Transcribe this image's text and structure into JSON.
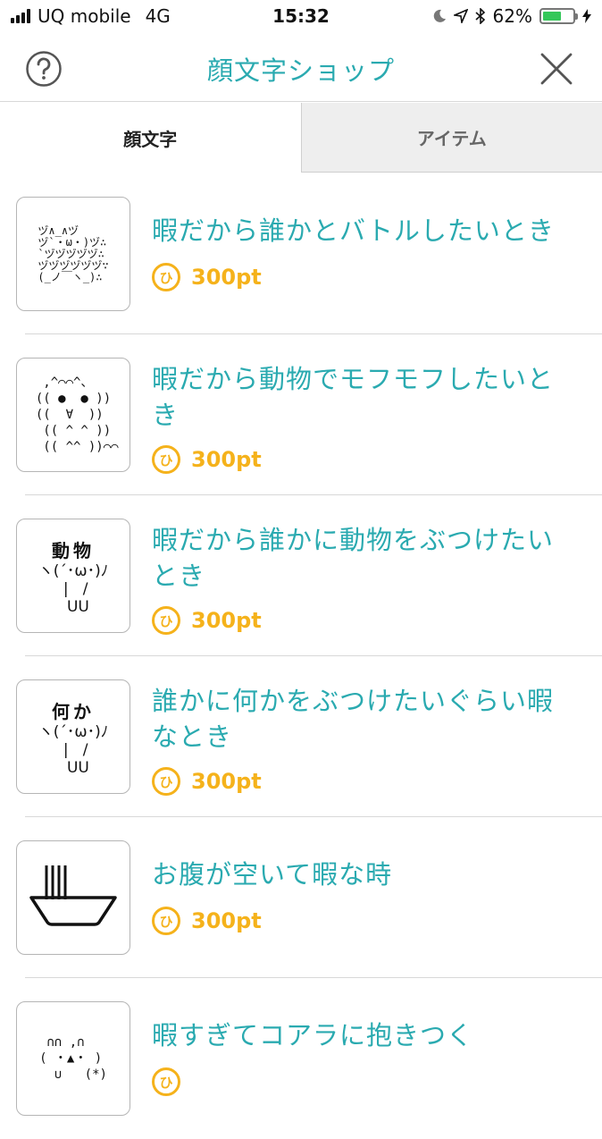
{
  "status_bar": {
    "carrier": "UQ mobile",
    "network": "4G",
    "time": "15:32",
    "battery": "62%",
    "battery_level": 0.62,
    "battery_color": "#34c759"
  },
  "nav": {
    "title": "顔文字ショップ",
    "help_icon": "question-circle-icon",
    "close_icon": "close-icon",
    "accent_color": "#2aaab0"
  },
  "tabs": [
    {
      "label": "顔文字",
      "active": true
    },
    {
      "label": "アイテム",
      "active": false
    }
  ],
  "items": [
    {
      "title": "暇だから誰かとバトルしたいとき",
      "price": "300pt",
      "coin": "ひ",
      "art": "ヅ∧_∧ヅ\nヅ`・ω・)ヅ∴\n`ヅヅヅヅヅ∴\nヅヅヅヅヅヅ∵\n(_ノ￣ヽ_)∴"
    },
    {
      "title": "暇だから動物でモフモフしたいとき",
      "price": "300pt",
      "coin": "ひ",
      "art": "  ,^⌒⌒^、\n (( ●  ● ))\n ((  ∀  ))\n  (( ^ ^ ))\n  (( ^^ ))⌒⌒"
    },
    {
      "title": "暇だから誰かに動物をぶつけたいとき",
      "price": "300pt",
      "coin": "ひ",
      "art_label": "動物",
      "art_face": "ヽ(´･ω･)ﾉ\n |   /\n  UU"
    },
    {
      "title": "誰かに何かをぶつけたいぐらい暇なとき",
      "price": "300pt",
      "coin": "ひ",
      "art_label": "何か",
      "art_face": "ヽ(´･ω･)ﾉ\n |   /\n  UU"
    },
    {
      "title": "お腹が空いて暇な時",
      "price": "300pt",
      "coin": "ひ",
      "art_icon": "ramen-bowl-icon"
    },
    {
      "title": "暇すぎてコアラに抱きつく",
      "price": "",
      "coin": "ひ",
      "art": " ∩∩ ,∩\n( ・▲・ )\n  ∪   (*)"
    }
  ],
  "coin_color": "#f5b21b"
}
